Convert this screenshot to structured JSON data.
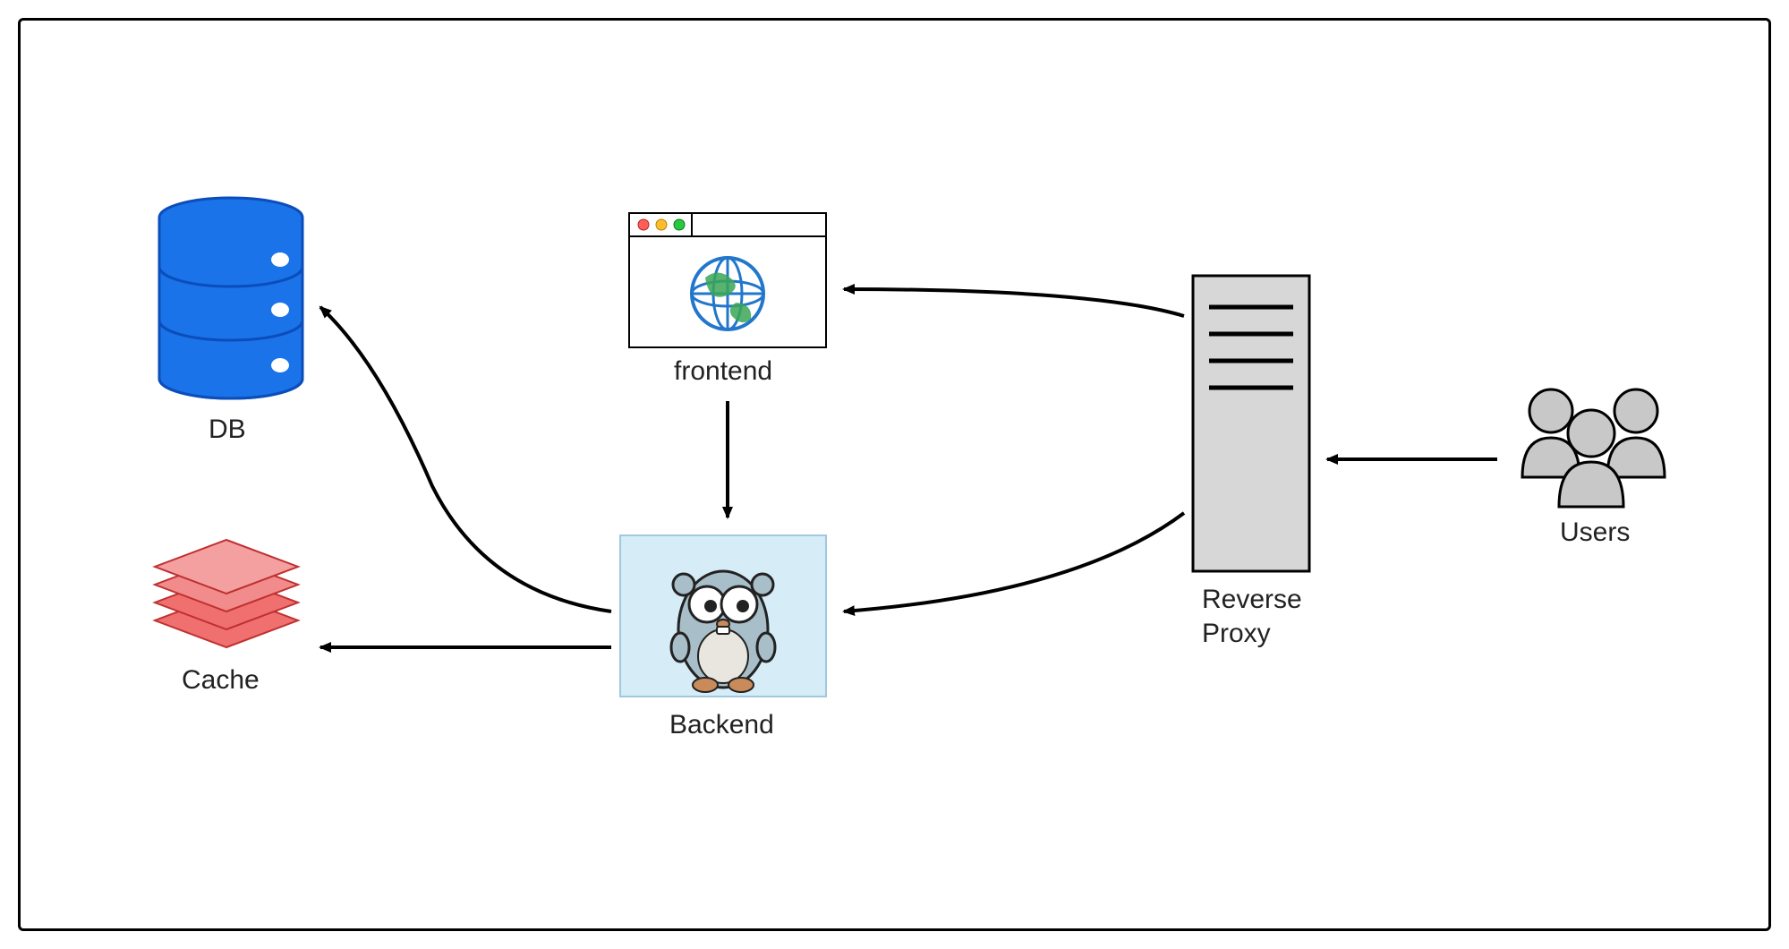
{
  "diagram": {
    "labels": {
      "db": "DB",
      "cache": "Cache",
      "frontend": "frontend",
      "backend": "Backend",
      "reverse_proxy_line1": "Reverse",
      "reverse_proxy_line2": "Proxy",
      "users": "Users"
    },
    "nodes": [
      {
        "id": "db",
        "type": "database",
        "label_key": "db"
      },
      {
        "id": "cache",
        "type": "cache-stack",
        "label_key": "cache"
      },
      {
        "id": "frontend",
        "type": "browser-window",
        "label_key": "frontend"
      },
      {
        "id": "backend",
        "type": "service-box",
        "label_key": "backend"
      },
      {
        "id": "reverse_proxy",
        "type": "server",
        "label_key": "reverse_proxy"
      },
      {
        "id": "users",
        "type": "people",
        "label_key": "users"
      }
    ],
    "arrows": [
      {
        "from": "users",
        "to": "reverse_proxy"
      },
      {
        "from": "reverse_proxy",
        "to": "frontend"
      },
      {
        "from": "reverse_proxy",
        "to": "backend"
      },
      {
        "from": "frontend",
        "to": "backend"
      },
      {
        "from": "backend",
        "to": "cache"
      },
      {
        "from": "backend",
        "to": "db"
      }
    ]
  }
}
